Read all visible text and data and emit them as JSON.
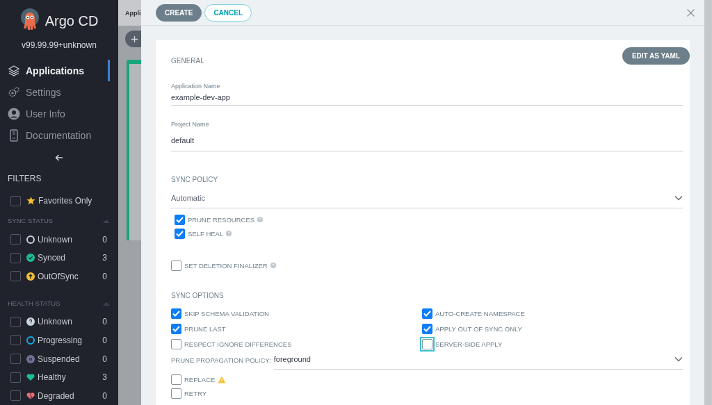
{
  "sidebar": {
    "app_name": "Argo CD",
    "version": "v99.99.99+unknown",
    "nav": [
      {
        "label": "Applications",
        "kind": "layers",
        "selected": true
      },
      {
        "label": "Settings",
        "kind": "gears",
        "selected": false
      },
      {
        "label": "User Info",
        "kind": "user",
        "selected": false
      },
      {
        "label": "Documentation",
        "kind": "doc",
        "selected": false
      }
    ],
    "filters_title": "FILTERS",
    "favorites": {
      "label": "Favorites Only",
      "checked": false
    },
    "groups": [
      {
        "title": "SYNC STATUS",
        "expanded": true,
        "items": [
          {
            "label": "Unknown",
            "kind": "ring",
            "color": "#cfd3d9",
            "count": "0",
            "checked": false
          },
          {
            "label": "Synced",
            "kind": "check",
            "color": "#18be94",
            "count": "3",
            "checked": false
          },
          {
            "label": "OutOfSync",
            "kind": "arrow",
            "color": "#f4c030",
            "count": "0",
            "checked": false
          }
        ]
      },
      {
        "title": "HEALTH STATUS",
        "expanded": true,
        "items": [
          {
            "label": "Unknown",
            "kind": "question",
            "color": "#ccd6dd",
            "count": "0",
            "checked": false
          },
          {
            "label": "Progressing",
            "kind": "ring",
            "color": "#0dadea",
            "count": "0",
            "checked": false
          },
          {
            "label": "Suspended",
            "kind": "pause",
            "color": "#766f94",
            "count": "0",
            "checked": false
          },
          {
            "label": "Healthy",
            "kind": "heart",
            "color": "#18be94",
            "count": "3",
            "checked": false
          },
          {
            "label": "Degraded",
            "kind": "broken",
            "color": "#e96d76",
            "count": "0",
            "checked": false
          }
        ]
      }
    ]
  },
  "background": {
    "tab_text": "Appli"
  },
  "panel": {
    "buttons": [
      {
        "label": "CREATE",
        "kind": "primary"
      },
      {
        "label": "CANCEL",
        "kind": "outline"
      }
    ],
    "edit_yaml": "EDIT AS YAML",
    "general_title": "GENERAL",
    "fields": [
      {
        "label": "Application Name",
        "value": "example-dev-app"
      },
      {
        "label": "Project Name",
        "value": "default"
      }
    ],
    "sync_policy": {
      "title": "SYNC POLICY",
      "value": "Automatic",
      "options": [
        {
          "label": "PRUNE RESOURCES",
          "checked": true,
          "kind": "help"
        },
        {
          "label": "SELF HEAL",
          "checked": true,
          "kind": "help"
        }
      ]
    },
    "finalizer": {
      "label": "SET DELETION FINALIZER",
      "checked": false,
      "kind": "help"
    },
    "sync_options": {
      "title": "SYNC OPTIONS",
      "left": [
        {
          "label": "SKIP SCHEMA VALIDATION",
          "checked": true,
          "focused": false
        },
        {
          "label": "PRUNE LAST",
          "checked": true,
          "focused": false
        },
        {
          "label": "RESPECT IGNORE DIFFERENCES",
          "checked": false,
          "focused": false
        }
      ],
      "right": [
        {
          "label": "AUTO-CREATE NAMESPACE",
          "checked": true,
          "focused": false
        },
        {
          "label": "APPLY OUT OF SYNC ONLY",
          "checked": true,
          "focused": false
        },
        {
          "label": "SERVER-SIDE APPLY",
          "checked": false,
          "focused": true
        }
      ]
    },
    "propagation": {
      "label": "PRUNE PROPAGATION POLICY:",
      "value": "foreground"
    },
    "extra": [
      {
        "label": "REPLACE",
        "checked": false,
        "kind": "warning"
      },
      {
        "label": "RETRY",
        "checked": false,
        "kind": "plain"
      }
    ]
  }
}
